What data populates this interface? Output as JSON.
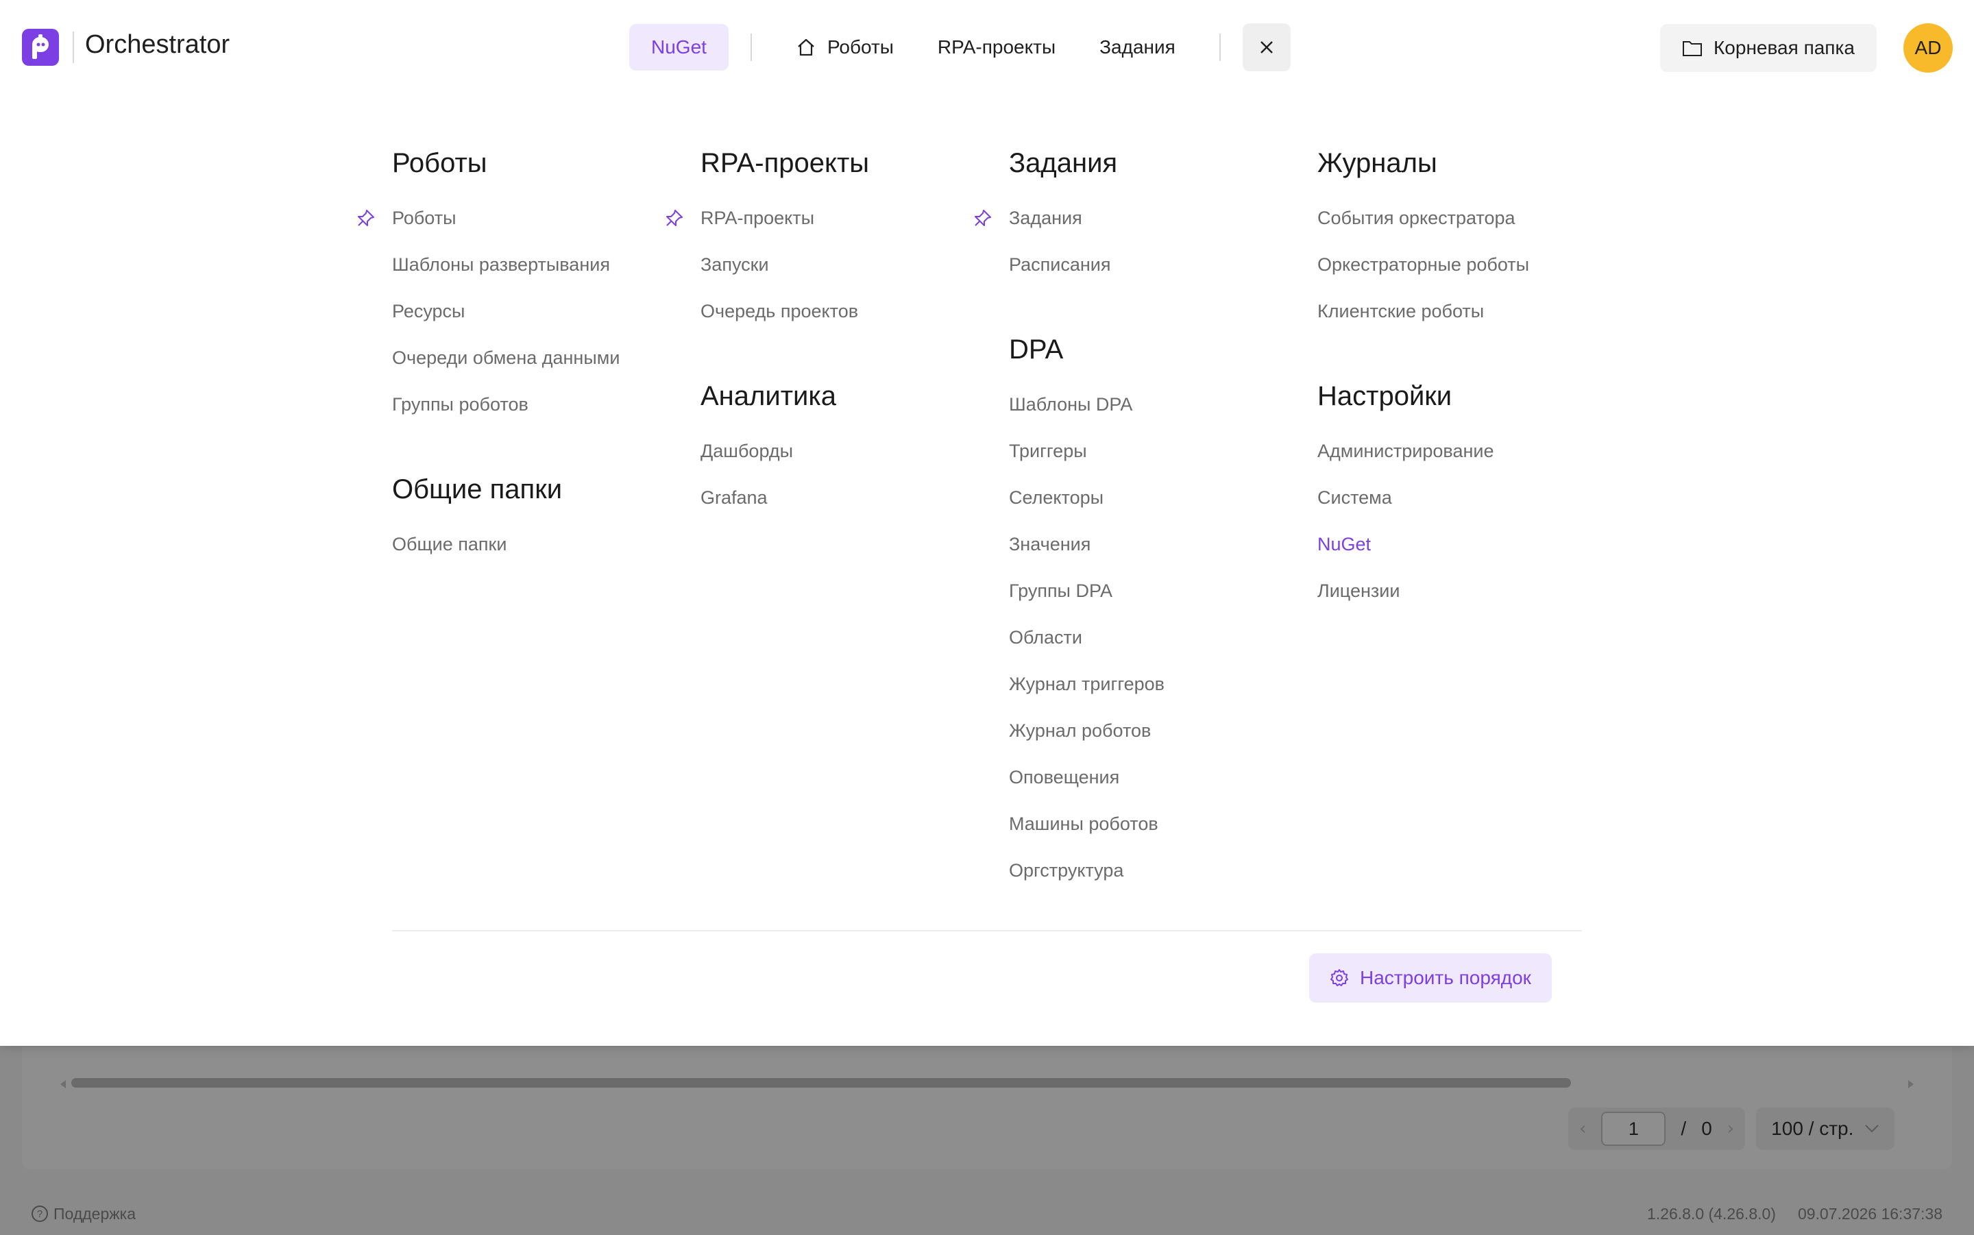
{
  "app": {
    "title": "Orchestrator"
  },
  "nav": {
    "active_label": "NuGet",
    "items": [
      {
        "label": "Роботы",
        "icon": "home-icon"
      },
      {
        "label": "RPA-проекты"
      },
      {
        "label": "Задания"
      }
    ],
    "close_icon": "close-icon"
  },
  "folder_button": {
    "label": "Корневая папка",
    "icon": "folder-icon"
  },
  "avatar": {
    "initials": "AD",
    "color": "#f8b92a"
  },
  "accent_color": "#7b3fe4",
  "menu": {
    "col1": {
      "sections": [
        {
          "title": "Роботы",
          "items": [
            "Роботы",
            "Шаблоны развертывания",
            "Ресурсы",
            "Очереди обмена данными",
            "Группы роботов"
          ]
        },
        {
          "title": "Общие папки",
          "items": [
            "Общие папки"
          ]
        }
      ]
    },
    "col2": {
      "sections": [
        {
          "title": "RPA-проекты",
          "items": [
            "RPA-проекты",
            "Запуски",
            "Очередь проектов"
          ]
        },
        {
          "title": "Аналитика",
          "items": [
            "Дашборды",
            "Grafana"
          ]
        }
      ]
    },
    "col3": {
      "sections": [
        {
          "title": "Задания",
          "items": [
            "Задания",
            "Расписания"
          ]
        },
        {
          "title": "DPA",
          "items": [
            "Шаблоны DPA",
            "Триггеры",
            "Селекторы",
            "Значения",
            "Группы DPA",
            "Области",
            "Журнал триггеров",
            "Журнал роботов",
            "Оповещения",
            "Машины роботов",
            "Оргструктура"
          ]
        }
      ]
    },
    "col4": {
      "sections": [
        {
          "title": "Журналы",
          "items": [
            "События оркестратора",
            "Оркестраторные роботы",
            "Клиентские роботы"
          ]
        },
        {
          "title": "Настройки",
          "items": [
            "Администрирование",
            "Система",
            "NuGet",
            "Лицензии"
          ]
        }
      ]
    }
  },
  "order_button": {
    "label": "Настроить порядок",
    "icon": "gear-icon"
  },
  "pager": {
    "current_page": "1",
    "separator": "/",
    "total_pages": "0",
    "page_size": "100 / стр."
  },
  "footer": {
    "support_label": "Поддержка",
    "version": "1.26.8.0 (4.26.8.0)",
    "timestamp": "09.07.2026 16:37:38"
  }
}
